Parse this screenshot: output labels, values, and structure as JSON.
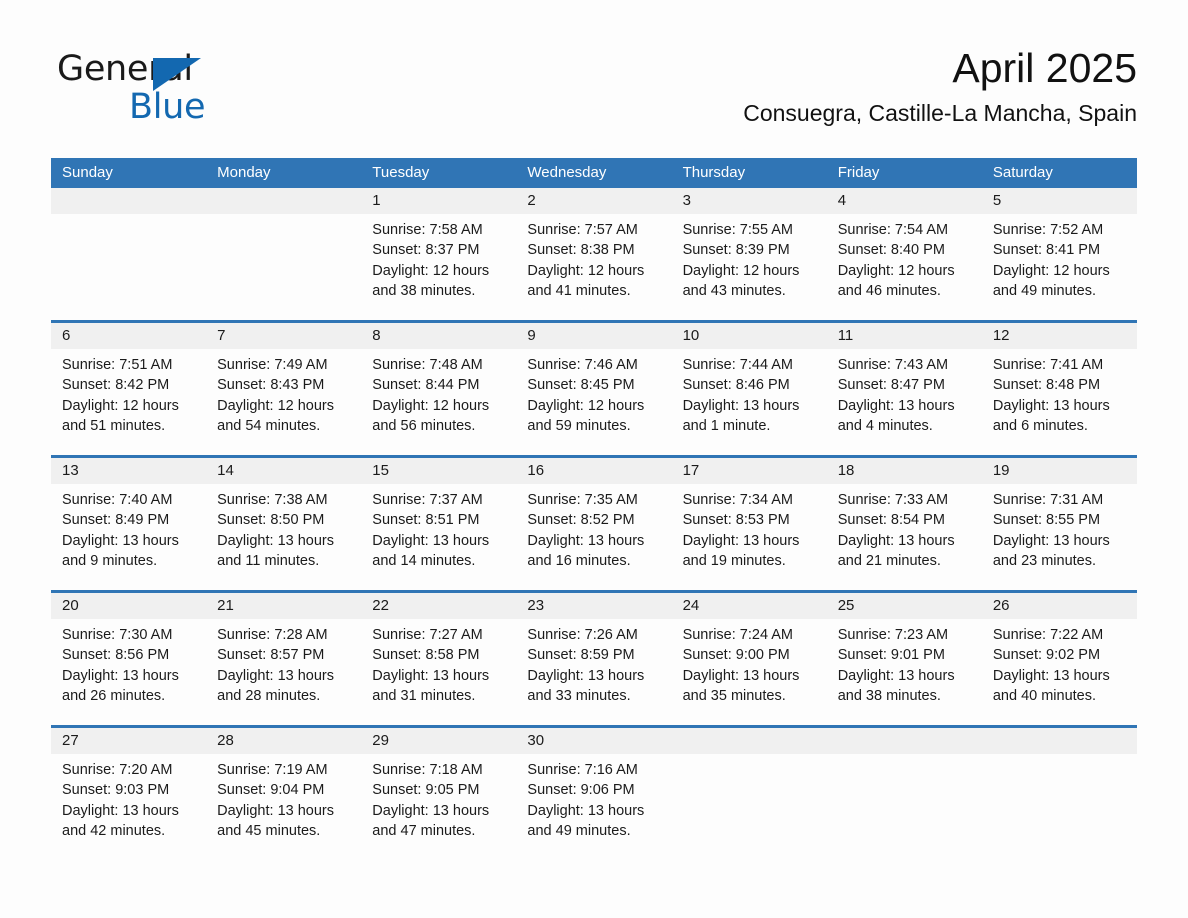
{
  "logo": {
    "text_general": "General",
    "text_blue": "Blue",
    "triangle_color": "#1368b0",
    "general_color": "#1a1a1a"
  },
  "header": {
    "month_title": "April 2025",
    "location": "Consuegra, Castille-La Mancha, Spain"
  },
  "theme": {
    "header_blue": "#3075b5",
    "day_band_gray": "#f0f0f0",
    "page_background": "#fdfdfd",
    "text_color": "#1b1b1b"
  },
  "calendar": {
    "weekdays": [
      "Sunday",
      "Monday",
      "Tuesday",
      "Wednesday",
      "Thursday",
      "Friday",
      "Saturday"
    ],
    "weeks": [
      [
        {
          "day": "",
          "sunrise": "",
          "sunset": "",
          "daylight": ""
        },
        {
          "day": "",
          "sunrise": "",
          "sunset": "",
          "daylight": ""
        },
        {
          "day": "1",
          "sunrise": "Sunrise: 7:58 AM",
          "sunset": "Sunset: 8:37 PM",
          "daylight": "Daylight: 12 hours and 38 minutes."
        },
        {
          "day": "2",
          "sunrise": "Sunrise: 7:57 AM",
          "sunset": "Sunset: 8:38 PM",
          "daylight": "Daylight: 12 hours and 41 minutes."
        },
        {
          "day": "3",
          "sunrise": "Sunrise: 7:55 AM",
          "sunset": "Sunset: 8:39 PM",
          "daylight": "Daylight: 12 hours and 43 minutes."
        },
        {
          "day": "4",
          "sunrise": "Sunrise: 7:54 AM",
          "sunset": "Sunset: 8:40 PM",
          "daylight": "Daylight: 12 hours and 46 minutes."
        },
        {
          "day": "5",
          "sunrise": "Sunrise: 7:52 AM",
          "sunset": "Sunset: 8:41 PM",
          "daylight": "Daylight: 12 hours and 49 minutes."
        }
      ],
      [
        {
          "day": "6",
          "sunrise": "Sunrise: 7:51 AM",
          "sunset": "Sunset: 8:42 PM",
          "daylight": "Daylight: 12 hours and 51 minutes."
        },
        {
          "day": "7",
          "sunrise": "Sunrise: 7:49 AM",
          "sunset": "Sunset: 8:43 PM",
          "daylight": "Daylight: 12 hours and 54 minutes."
        },
        {
          "day": "8",
          "sunrise": "Sunrise: 7:48 AM",
          "sunset": "Sunset: 8:44 PM",
          "daylight": "Daylight: 12 hours and 56 minutes."
        },
        {
          "day": "9",
          "sunrise": "Sunrise: 7:46 AM",
          "sunset": "Sunset: 8:45 PM",
          "daylight": "Daylight: 12 hours and 59 minutes."
        },
        {
          "day": "10",
          "sunrise": "Sunrise: 7:44 AM",
          "sunset": "Sunset: 8:46 PM",
          "daylight": "Daylight: 13 hours and 1 minute."
        },
        {
          "day": "11",
          "sunrise": "Sunrise: 7:43 AM",
          "sunset": "Sunset: 8:47 PM",
          "daylight": "Daylight: 13 hours and 4 minutes."
        },
        {
          "day": "12",
          "sunrise": "Sunrise: 7:41 AM",
          "sunset": "Sunset: 8:48 PM",
          "daylight": "Daylight: 13 hours and 6 minutes."
        }
      ],
      [
        {
          "day": "13",
          "sunrise": "Sunrise: 7:40 AM",
          "sunset": "Sunset: 8:49 PM",
          "daylight": "Daylight: 13 hours and 9 minutes."
        },
        {
          "day": "14",
          "sunrise": "Sunrise: 7:38 AM",
          "sunset": "Sunset: 8:50 PM",
          "daylight": "Daylight: 13 hours and 11 minutes."
        },
        {
          "day": "15",
          "sunrise": "Sunrise: 7:37 AM",
          "sunset": "Sunset: 8:51 PM",
          "daylight": "Daylight: 13 hours and 14 minutes."
        },
        {
          "day": "16",
          "sunrise": "Sunrise: 7:35 AM",
          "sunset": "Sunset: 8:52 PM",
          "daylight": "Daylight: 13 hours and 16 minutes."
        },
        {
          "day": "17",
          "sunrise": "Sunrise: 7:34 AM",
          "sunset": "Sunset: 8:53 PM",
          "daylight": "Daylight: 13 hours and 19 minutes."
        },
        {
          "day": "18",
          "sunrise": "Sunrise: 7:33 AM",
          "sunset": "Sunset: 8:54 PM",
          "daylight": "Daylight: 13 hours and 21 minutes."
        },
        {
          "day": "19",
          "sunrise": "Sunrise: 7:31 AM",
          "sunset": "Sunset: 8:55 PM",
          "daylight": "Daylight: 13 hours and 23 minutes."
        }
      ],
      [
        {
          "day": "20",
          "sunrise": "Sunrise: 7:30 AM",
          "sunset": "Sunset: 8:56 PM",
          "daylight": "Daylight: 13 hours and 26 minutes."
        },
        {
          "day": "21",
          "sunrise": "Sunrise: 7:28 AM",
          "sunset": "Sunset: 8:57 PM",
          "daylight": "Daylight: 13 hours and 28 minutes."
        },
        {
          "day": "22",
          "sunrise": "Sunrise: 7:27 AM",
          "sunset": "Sunset: 8:58 PM",
          "daylight": "Daylight: 13 hours and 31 minutes."
        },
        {
          "day": "23",
          "sunrise": "Sunrise: 7:26 AM",
          "sunset": "Sunset: 8:59 PM",
          "daylight": "Daylight: 13 hours and 33 minutes."
        },
        {
          "day": "24",
          "sunrise": "Sunrise: 7:24 AM",
          "sunset": "Sunset: 9:00 PM",
          "daylight": "Daylight: 13 hours and 35 minutes."
        },
        {
          "day": "25",
          "sunrise": "Sunrise: 7:23 AM",
          "sunset": "Sunset: 9:01 PM",
          "daylight": "Daylight: 13 hours and 38 minutes."
        },
        {
          "day": "26",
          "sunrise": "Sunrise: 7:22 AM",
          "sunset": "Sunset: 9:02 PM",
          "daylight": "Daylight: 13 hours and 40 minutes."
        }
      ],
      [
        {
          "day": "27",
          "sunrise": "Sunrise: 7:20 AM",
          "sunset": "Sunset: 9:03 PM",
          "daylight": "Daylight: 13 hours and 42 minutes."
        },
        {
          "day": "28",
          "sunrise": "Sunrise: 7:19 AM",
          "sunset": "Sunset: 9:04 PM",
          "daylight": "Daylight: 13 hours and 45 minutes."
        },
        {
          "day": "29",
          "sunrise": "Sunrise: 7:18 AM",
          "sunset": "Sunset: 9:05 PM",
          "daylight": "Daylight: 13 hours and 47 minutes."
        },
        {
          "day": "30",
          "sunrise": "Sunrise: 7:16 AM",
          "sunset": "Sunset: 9:06 PM",
          "daylight": "Daylight: 13 hours and 49 minutes."
        },
        {
          "day": "",
          "sunrise": "",
          "sunset": "",
          "daylight": ""
        },
        {
          "day": "",
          "sunrise": "",
          "sunset": "",
          "daylight": ""
        },
        {
          "day": "",
          "sunrise": "",
          "sunset": "",
          "daylight": ""
        }
      ]
    ]
  }
}
